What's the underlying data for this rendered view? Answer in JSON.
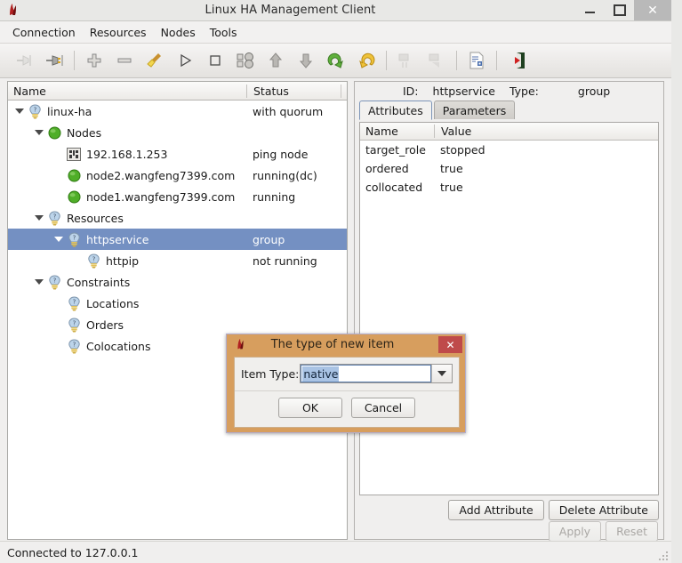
{
  "window": {
    "title": "Linux HA Management Client",
    "icon": "app-icon",
    "controls": {
      "minimize": "–",
      "maximize": "□",
      "close": "✕"
    }
  },
  "menubar": {
    "items": [
      {
        "label": "Connection"
      },
      {
        "label": "Resources"
      },
      {
        "label": "Nodes"
      },
      {
        "label": "Tools"
      }
    ]
  },
  "toolbar": {
    "buttons": [
      {
        "name": "disconnect-icon",
        "enabled": false
      },
      {
        "name": "connect-icon",
        "enabled": true
      },
      {
        "name": "add-icon",
        "enabled": true
      },
      {
        "name": "remove-icon",
        "enabled": true
      },
      {
        "name": "cleanup-broom-icon",
        "enabled": true
      },
      {
        "name": "start-icon",
        "enabled": true
      },
      {
        "name": "stop-icon",
        "enabled": true
      },
      {
        "name": "manage-icon",
        "enabled": true
      },
      {
        "name": "move-up-icon",
        "enabled": true
      },
      {
        "name": "move-down-icon",
        "enabled": true
      },
      {
        "name": "migrate-icon",
        "enabled": true
      },
      {
        "name": "unmigrate-icon",
        "enabled": true
      },
      {
        "name": "standby-icon",
        "enabled": false
      },
      {
        "name": "active-icon",
        "enabled": false
      },
      {
        "name": "cib-document-icon",
        "enabled": true
      },
      {
        "name": "exit-icon",
        "enabled": true
      }
    ]
  },
  "tree": {
    "columns": {
      "name": "Name",
      "status": "Status"
    },
    "rows": [
      {
        "label": "linux-ha",
        "status": "with quorum",
        "indent": 0,
        "twisty": "open",
        "icon": "bulb-icon",
        "selected": false
      },
      {
        "label": "Nodes",
        "status": "",
        "indent": 1,
        "twisty": "open",
        "icon": "green-ball-icon",
        "selected": false
      },
      {
        "label": "192.168.1.253",
        "status": "ping node",
        "indent": 2,
        "twisty": "none",
        "icon": "ping-node-icon",
        "selected": false
      },
      {
        "label": "node2.wangfeng7399.com",
        "status": "running(dc)",
        "indent": 2,
        "twisty": "none",
        "icon": "green-ball-icon",
        "selected": false
      },
      {
        "label": "node1.wangfeng7399.com",
        "status": "running",
        "indent": 2,
        "twisty": "none",
        "icon": "green-ball-icon",
        "selected": false
      },
      {
        "label": "Resources",
        "status": "",
        "indent": 1,
        "twisty": "open",
        "icon": "bulb-icon",
        "selected": false
      },
      {
        "label": "httpservice",
        "status": "group",
        "indent": 2,
        "twisty": "open",
        "icon": "bulb-icon",
        "selected": true
      },
      {
        "label": "httpip",
        "status": "not running",
        "indent": 3,
        "twisty": "none",
        "icon": "bulb-icon",
        "selected": false
      },
      {
        "label": "Constraints",
        "status": "",
        "indent": 1,
        "twisty": "open",
        "icon": "bulb-icon",
        "selected": false
      },
      {
        "label": "Locations",
        "status": "",
        "indent": 2,
        "twisty": "none",
        "icon": "bulb-icon",
        "selected": false
      },
      {
        "label": "Orders",
        "status": "",
        "indent": 2,
        "twisty": "none",
        "icon": "bulb-icon",
        "selected": false
      },
      {
        "label": "Colocations",
        "status": "",
        "indent": 2,
        "twisty": "none",
        "icon": "bulb-icon",
        "selected": false
      }
    ]
  },
  "detail": {
    "id_label": "ID:",
    "id_value": "httpservice",
    "type_label": "Type:",
    "type_value": "group",
    "tabs": [
      {
        "label": "Attributes",
        "active": true
      },
      {
        "label": "Parameters",
        "active": false
      }
    ],
    "table": {
      "columns": {
        "name": "Name",
        "value": "Value"
      },
      "rows": [
        {
          "name": "target_role",
          "value": "stopped"
        },
        {
          "name": "ordered",
          "value": "true"
        },
        {
          "name": "collocated",
          "value": "true"
        }
      ]
    },
    "buttons": {
      "add_attribute": "Add Attribute",
      "delete_attribute": "Delete Attribute",
      "apply": "Apply",
      "reset": "Reset"
    }
  },
  "statusbar": {
    "text": "Connected to 127.0.0.1"
  },
  "dialog": {
    "title": "The type of new item",
    "close": "✕",
    "icon": "app-icon",
    "field_label": "Item Type:",
    "field_value": "native",
    "ok": "OK",
    "cancel": "Cancel"
  },
  "colors": {
    "selection_blue": "#7490c2",
    "dialog_frame": "#d79e5e",
    "dialog_close_red": "#bf4a4a",
    "tab_active_border": "#7c95b8",
    "combo_selection": "#a9c3e4"
  }
}
